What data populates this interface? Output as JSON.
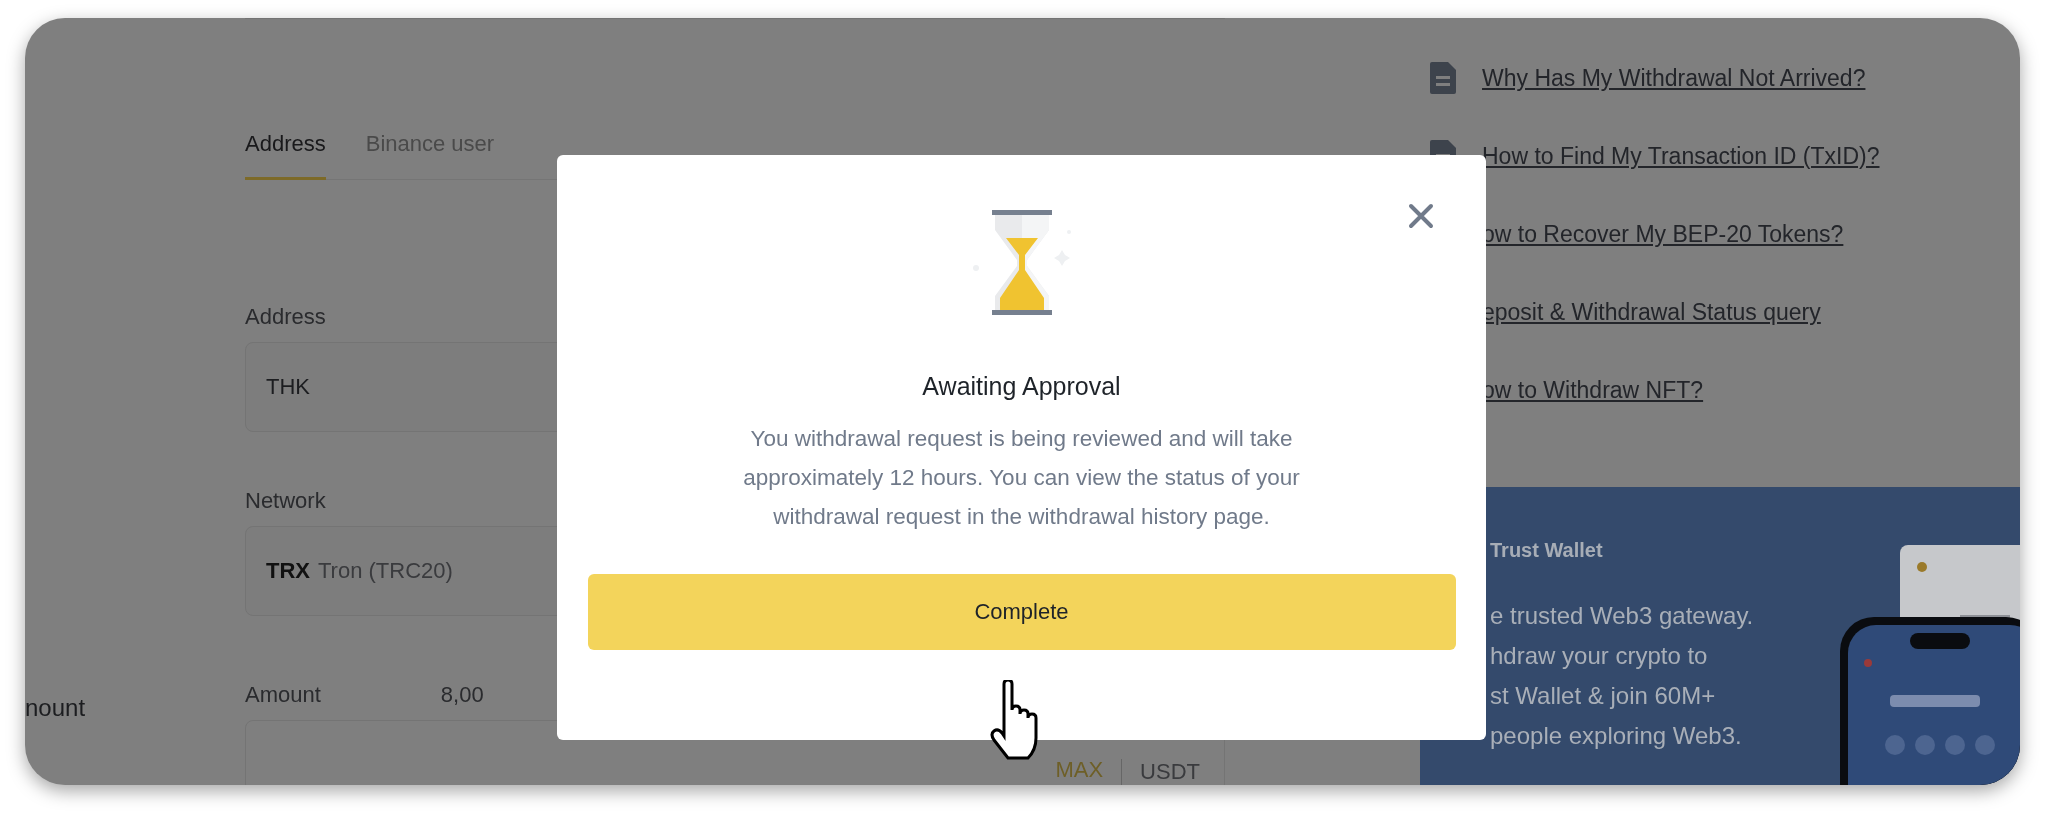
{
  "tabs": [
    {
      "label": "Address",
      "selected": true
    },
    {
      "label": "Binance user",
      "selected": false
    }
  ],
  "address_field": {
    "label": "Address",
    "value": "THK"
  },
  "network_field": {
    "label": "Network",
    "code": "TRX",
    "name": "Tron (TRC20)"
  },
  "amount": {
    "side_label": "nount",
    "label": "Amount",
    "available": "8,00",
    "max": "MAX",
    "unit": "USDT"
  },
  "help_links": [
    {
      "text": "Why Has My Withdrawal Not Arrived?",
      "icon": true
    },
    {
      "text": "How to Find My Transaction ID (TxID)?",
      "icon": true
    },
    {
      "text": "ow to Recover My BEP-20 Tokens?",
      "icon": false
    },
    {
      "text": "eposit & Withdrawal Status query",
      "icon": false
    },
    {
      "text": "ow to Withdraw NFT?",
      "icon": false
    }
  ],
  "banner": {
    "brand": "Trust Wallet",
    "lines": [
      "e trusted Web3 gateway.",
      "hdraw your crypto to",
      "st Wallet & join 60M+",
      "people exploring Web3."
    ]
  },
  "dialog": {
    "title": "Awaiting Approval",
    "message": "You withdrawal request is being reviewed and will take approximately 12 hours. You can view the status of your withdrawal request in the withdrawal history page.",
    "button": "Complete"
  }
}
